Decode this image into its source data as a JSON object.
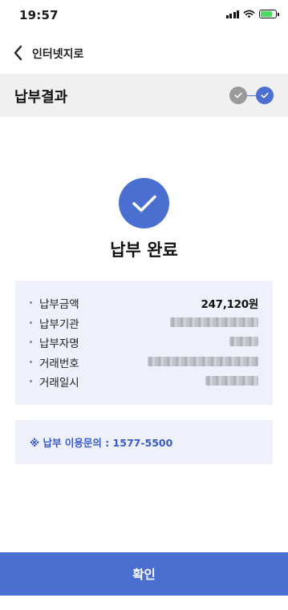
{
  "status_bar": {
    "time": "19:57"
  },
  "nav": {
    "title": "인터넷지로"
  },
  "step_header": {
    "title": "납부결과"
  },
  "result": {
    "title": "납부 완료"
  },
  "details": [
    {
      "label": "납부금액",
      "value": "247,120원",
      "masked": false
    },
    {
      "label": "납부기관",
      "value": "",
      "masked": true
    },
    {
      "label": "납부자명",
      "value": "",
      "masked": true
    },
    {
      "label": "거래번호",
      "value": "",
      "masked": true
    },
    {
      "label": "거래일시",
      "value": "",
      "masked": true
    }
  ],
  "inquiry": {
    "text": "※ 납부 이용문의 : 1577-5500"
  },
  "confirm_button": {
    "label": "확인"
  },
  "colors": {
    "accent": "#4a6fd1",
    "card_bg": "#eef0fa",
    "step_done": "#9a9a9a"
  }
}
